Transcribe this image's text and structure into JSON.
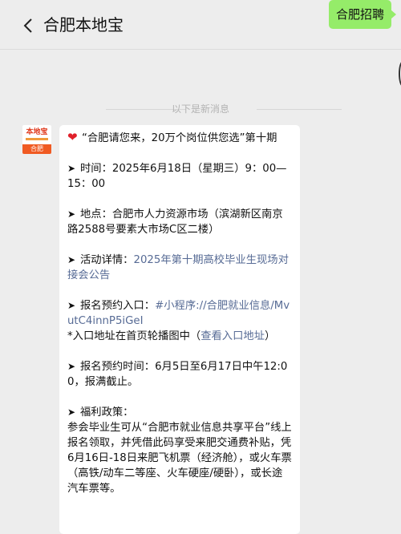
{
  "header": {
    "title": "合肥本地宝"
  },
  "outgoing": {
    "text": "合肥招聘"
  },
  "system": {
    "divider_text": "以下是新消息"
  },
  "avatar": {
    "logo_text": "本地宝",
    "band_text": "合肥"
  },
  "article": {
    "headline": "“合肥请您来，20万个岗位供您选”第十期",
    "time_label": "时间：",
    "time_value": "2025年6月18日（星期三）9：00—15：00",
    "place_label": "地点：",
    "place_value": "合肥市人力资源市场（滨湖新区南京路2588号要素大市场C区二楼）",
    "detail_label": "活动详情：",
    "detail_link": "2025年第十期高校毕业生现场对接会公告",
    "entry_label": "报名预约入口：",
    "entry_link": "#小程序://合肥就业信息/MvutC4innP5iGeI",
    "entry_note_prefix": "*入口地址在首页轮播图中（",
    "entry_note_link": "查看入口地址",
    "entry_note_suffix": "）",
    "signup_label": "报名预约时间：",
    "signup_value": "6月5日至6月17日中午12:00，报满截止。",
    "welfare_label": "福利政策：",
    "welfare_text": "参会毕业生可从“合肥市就业信息共享平台”线上报名领取，并凭借此码享受来肥交通费补贴，凭6月16日-18日来肥飞机票（经济舱），或火车票（高铁/动车二等座、火车硬座/硬卧），或长途汽车票等。"
  }
}
